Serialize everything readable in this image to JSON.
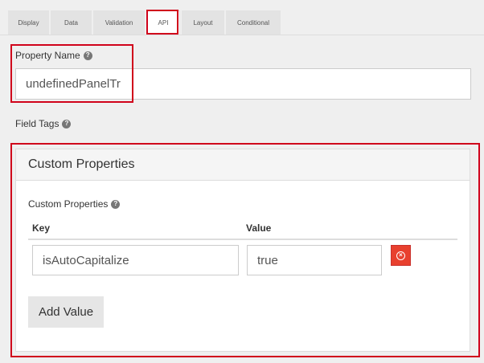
{
  "tabs": [
    {
      "label": "Display"
    },
    {
      "label": "Data"
    },
    {
      "label": "Validation"
    },
    {
      "label": "API"
    },
    {
      "label": "Layout"
    },
    {
      "label": "Conditional"
    }
  ],
  "property_name": {
    "label": "Property Name",
    "value": "undefinedPanelTr"
  },
  "field_tags": {
    "label": "Field Tags"
  },
  "custom_properties_panel": {
    "title": "Custom Properties",
    "field_label": "Custom Properties",
    "columns": {
      "key": "Key",
      "value": "Value"
    },
    "rows": [
      {
        "key": "isAutoCapitalize",
        "value": "true"
      }
    ],
    "add_button": "Add Value"
  },
  "colors": {
    "highlight": "#d0021b",
    "remove_button": "#e8402e"
  }
}
